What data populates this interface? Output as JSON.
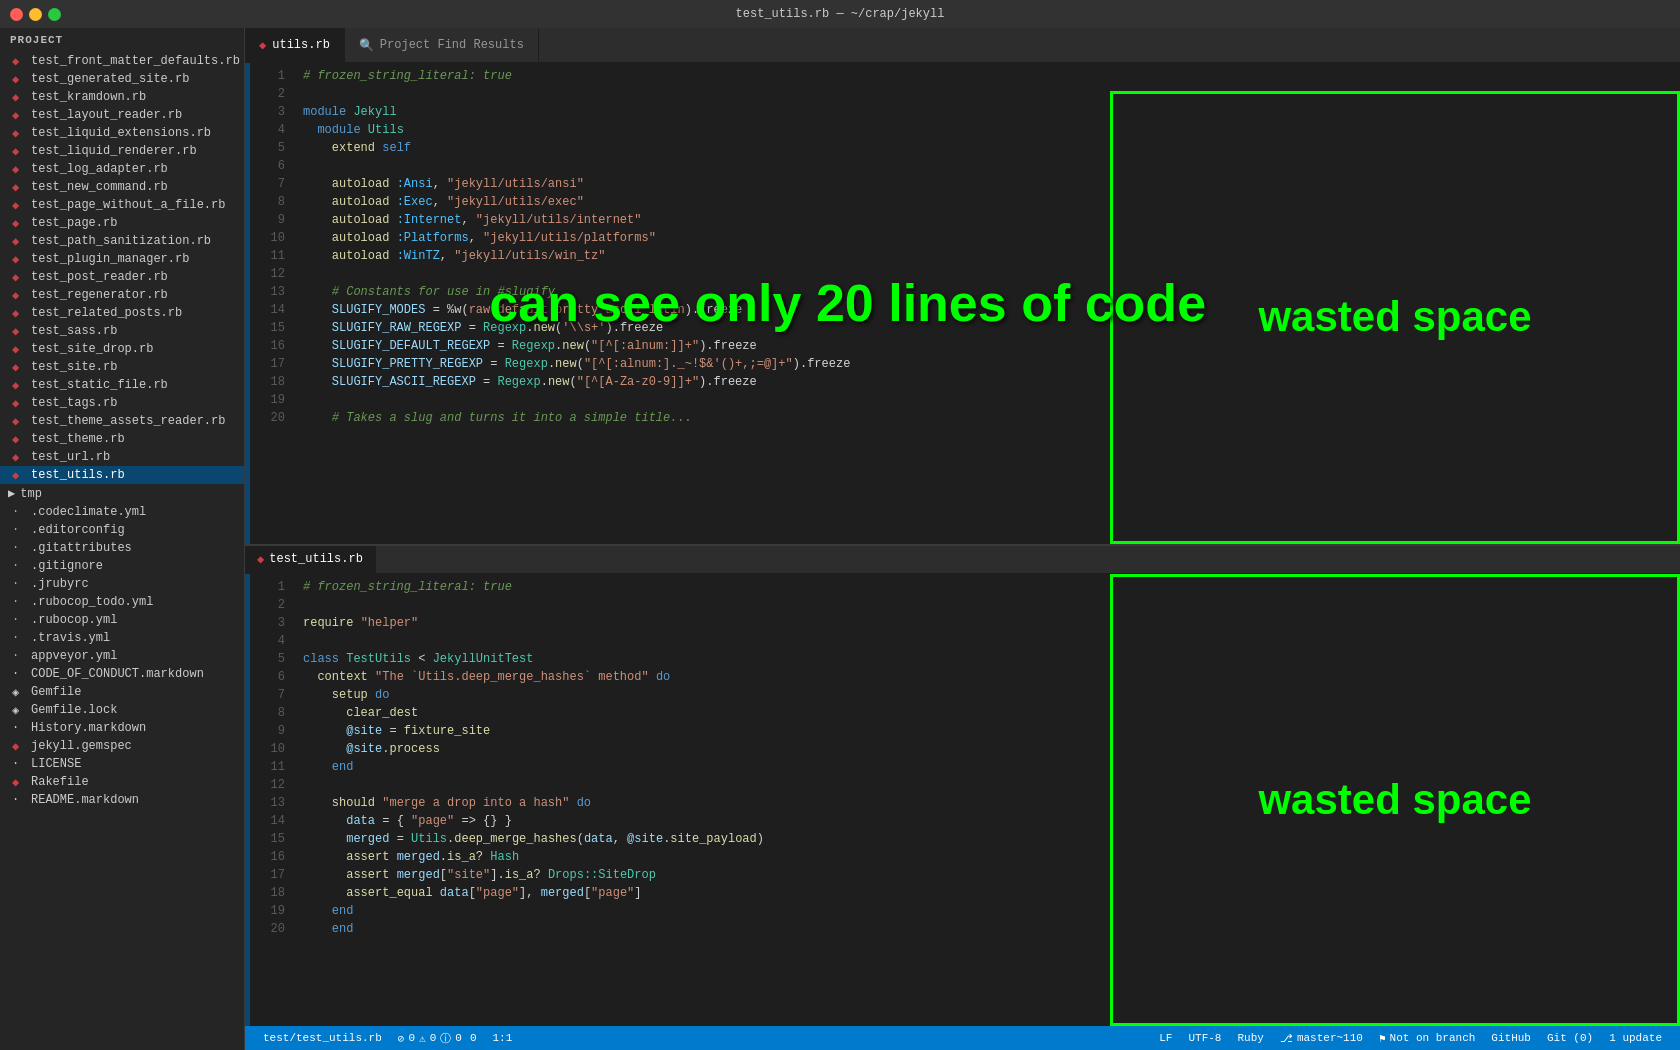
{
  "titlebar": {
    "title": "test_utils.rb — ~/crap/jekyll"
  },
  "tabs": {
    "utils_tab": "utils.rb",
    "search_tab": "Project Find Results"
  },
  "sidebar": {
    "header": "Project",
    "items": [
      "test_front_matter_defaults.rb",
      "test_generated_site.rb",
      "test_kramdown.rb",
      "test_layout_reader.rb",
      "test_liquid_extensions.rb",
      "test_liquid_renderer.rb",
      "test_log_adapter.rb",
      "test_new_command.rb",
      "test_page_without_a_file.rb",
      "test_page.rb",
      "test_path_sanitization.rb",
      "test_plugin_manager.rb",
      "test_post_reader.rb",
      "test_regenerator.rb",
      "test_related_posts.rb",
      "test_sass.rb",
      "test_site_drop.rb",
      "test_site.rb",
      "test_static_file.rb",
      "test_tags.rb",
      "test_theme_assets_reader.rb",
      "test_theme.rb",
      "test_url.rb",
      "test_utils.rb"
    ],
    "folders": [
      "tmp",
      ".codeclimate.yml",
      ".editorconfig",
      ".gitattributes",
      ".gitignore",
      ".jrubyrc",
      ".rubocop_todo.yml",
      ".rubocop.yml",
      ".travis.yml",
      "appveyor.yml",
      "CODE_OF_CONDUCT.markdown",
      "Gemfile",
      "Gemfile.lock",
      "History.markdown",
      "jekyll.gemspec",
      "LICENSE",
      "Rakefile",
      "README.markdown"
    ]
  },
  "editor_top": {
    "tab_label": "utils.rb",
    "lines": [
      "# frozen_string_literal: true",
      "",
      "module Jekyll",
      "  module Utils",
      "    extend self",
      "",
      "    autoload :Ansi, \"jekyll/utils/ansi\"",
      "    autoload :Exec, \"jekyll/utils/exec\"",
      "    autoload :Internet, \"jekyll/utils/internet\"",
      "    autoload :Platforms, \"jekyll/utils/platforms\"",
      "    autoload :WinTZ, \"jekyll/utils/win_tz\"",
      "",
      "    # Constants for use in #slugify",
      "    SLUGIFY_MODES = %w(raw default pretty ascii latin).freeze",
      "    SLUGIFY_RAW_REGEXP = Regexp.new('\\\\s+').freeze",
      "    SLUGIFY_DEFAULT_REGEXP = Regexp.new(\"[^[:alnum:]]+\").freeze",
      "    SLUGIFY_PRETTY_REGEXP = Regexp.new(\"[^[:alnum:]._~!$&'()+,;=@]+\").freeze",
      "    SLUGIFY_ASCII_REGEXP = Regexp.new(\"[^[A-Za-z0-9]]+\").freeze",
      "",
      "    # Takes a slug and turns it into a simple title..."
    ]
  },
  "editor_bottom": {
    "tab_label": "test_utils.rb",
    "lines": [
      "# frozen_string_literal: true",
      "",
      "require \"helper\"",
      "",
      "class TestUtils < JekyllUnitTest",
      "  context \"The `Utils.deep_merge_hashes` method\" do",
      "    setup do",
      "      clear_dest",
      "      @site = fixture_site",
      "      @site.process",
      "    end",
      "",
      "    should \"merge a drop into a hash\" do",
      "      data = { \"page\" => {} }",
      "      merged = Utils.deep_merge_hashes(data, @site.site_payload)",
      "      assert merged.is_a? Hash",
      "      assert merged[\"site\"].is_a? Drops::SiteDrop",
      "      assert_equal data[\"page\"], merged[\"page\"]",
      "    end",
      "    end"
    ]
  },
  "overlay": {
    "can_see": "can see only 20 lines of code",
    "wasted_top": "wasted space",
    "wasted_bottom": "wasted space"
  },
  "status_bar": {
    "file_path": "test/test_utils.rb",
    "errors": "0",
    "warnings": "0",
    "infos": "0",
    "hints": "0",
    "position": "1:1",
    "encoding": "LF",
    "charset": "UTF-8",
    "language": "Ruby",
    "branch": "master~110",
    "not_on_branch": "Not on branch",
    "github": "GitHub",
    "git": "Git (0)",
    "update": "1 update"
  }
}
